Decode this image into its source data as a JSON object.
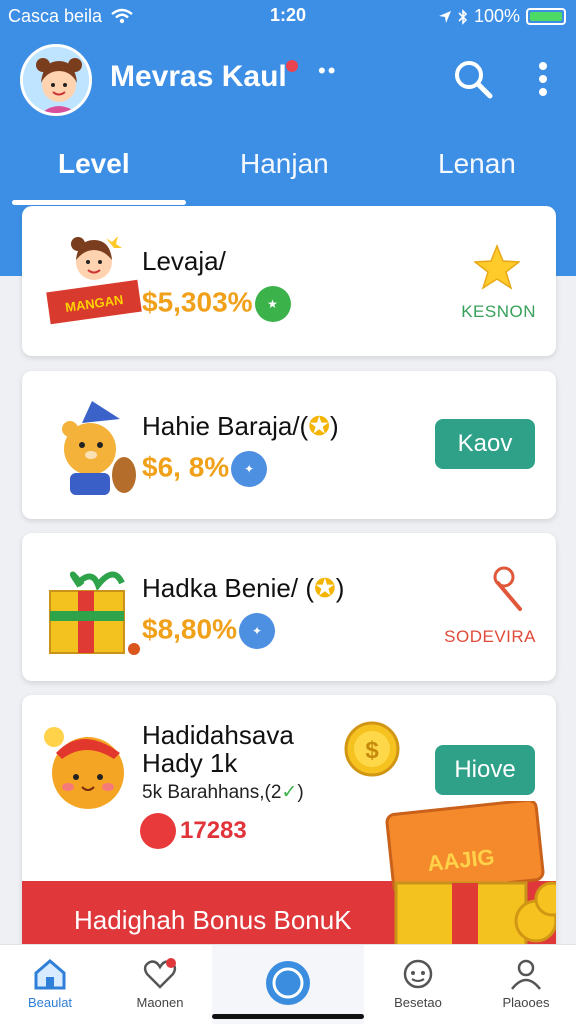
{
  "status_bar": {
    "carrier": "Casca beila",
    "time": "1:20",
    "battery": "100%"
  },
  "app": {
    "title": "Mevras Kaul"
  },
  "tabs": [
    {
      "label": "Level"
    },
    {
      "label": "Hanjan"
    },
    {
      "label": "Lenan"
    }
  ],
  "cards": [
    {
      "title": "Levaja/",
      "value": "$5,303%",
      "right_label": "KESNON",
      "banner_text": "MANGAN"
    },
    {
      "title": "Hahie Baraja/(",
      "value": "$6, 8%",
      "button_label": "Kaov"
    },
    {
      "title": "Hadka Benie/ (",
      "value": "$8,80%",
      "right_label": "SODEVIRA"
    },
    {
      "title_line1": "Hadidahsava",
      "title_line2": "Hady 1k",
      "subtitle": "5k Barahhans,(2",
      "count": "17283",
      "button_label": "Hiove"
    }
  ],
  "promo": {
    "text": "Hadighah Bonus BonuK",
    "chest_label": "AAJIG"
  },
  "bottom_nav": [
    {
      "label": "Beaulat",
      "icon": "home-icon"
    },
    {
      "label": "Maonen",
      "icon": "heart-icon"
    },
    {
      "label": "",
      "icon": "compass-icon"
    },
    {
      "label": "Besetao",
      "icon": "chat-icon"
    },
    {
      "label": "Plaooes",
      "icon": "profile-icon"
    }
  ],
  "colors": {
    "header": "#3d8fe6",
    "accent_teal": "#2fa189",
    "value_orange": "#f0a019",
    "promo_red": "#e0373b"
  }
}
